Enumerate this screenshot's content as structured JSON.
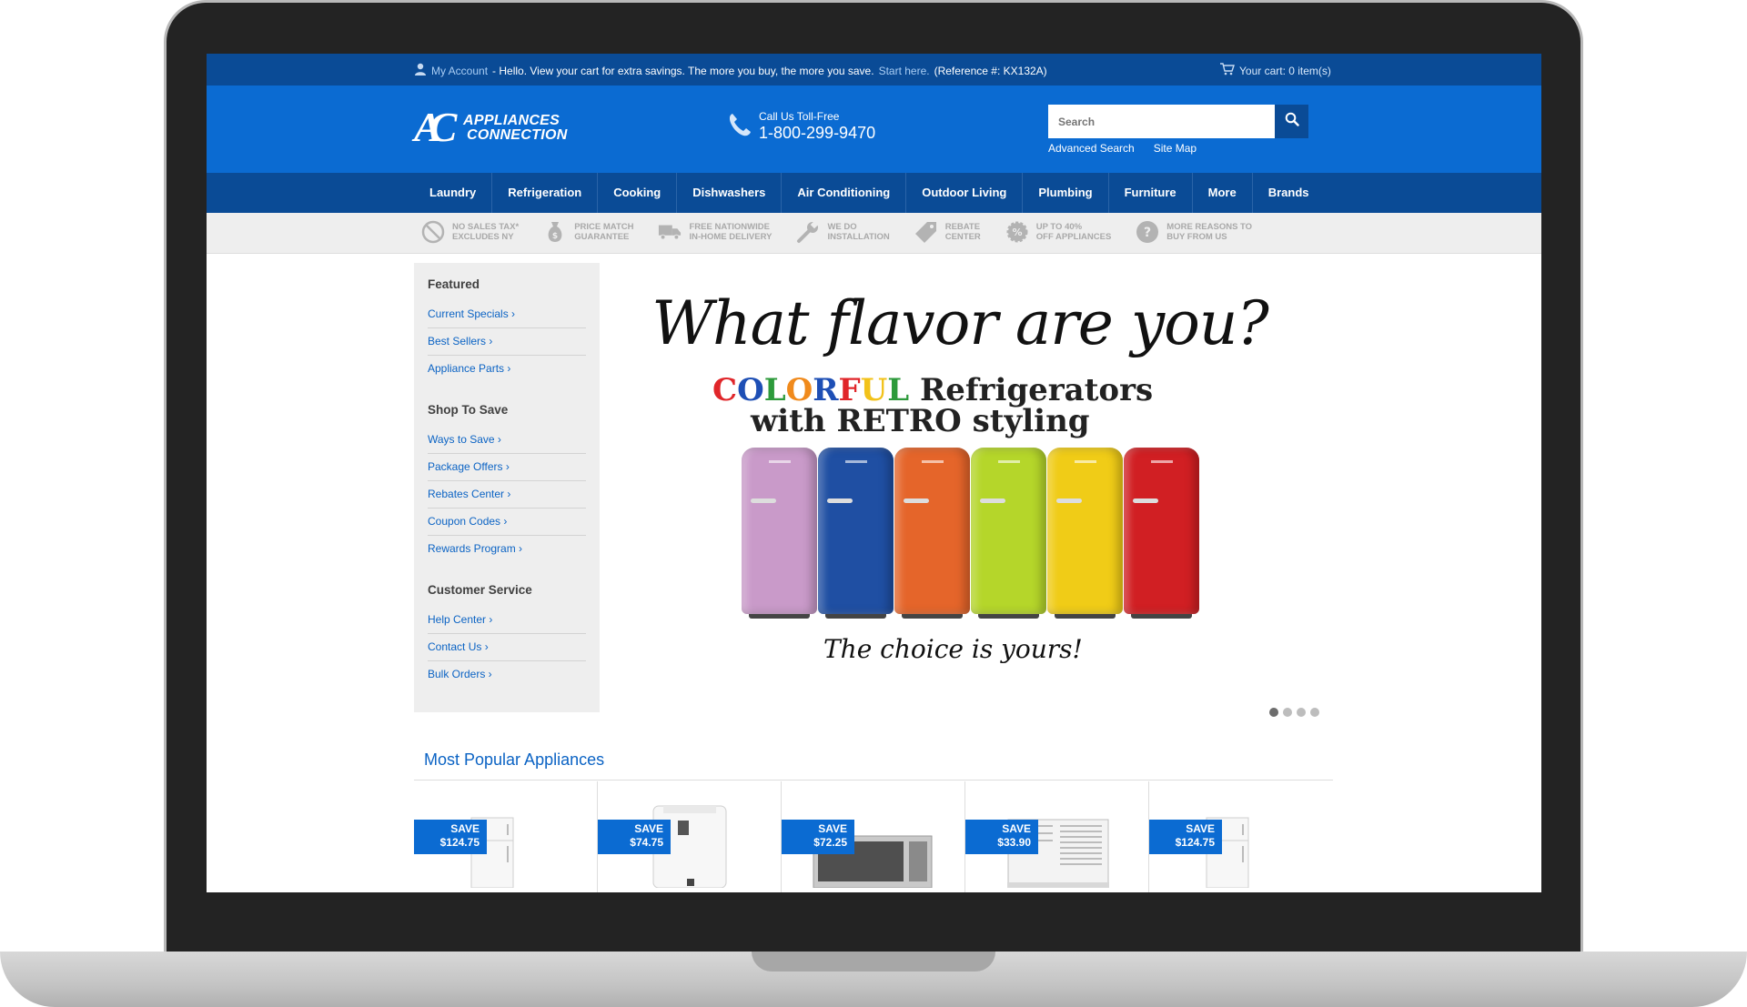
{
  "topbar": {
    "account": "My Account",
    "message": "- Hello. View your cart for extra savings. The more you buy, the more you save.",
    "start_link": "Start here.",
    "reference": "(Reference #: KX132A)",
    "cart": "Your cart: 0 item(s)"
  },
  "header": {
    "logo_line1": "APPLIANCES",
    "logo_line2": "CONNECTION",
    "logo_mark": "AC",
    "phone_label": "Call Us Toll-Free",
    "phone_number": "1-800-299-9470",
    "search_placeholder": "Search",
    "advanced_search": "Advanced Search",
    "site_map": "Site Map"
  },
  "nav": [
    "Laundry",
    "Refrigeration",
    "Cooking",
    "Dishwashers",
    "Air Conditioning",
    "Outdoor Living",
    "Plumbing",
    "Furniture",
    "More",
    "Brands"
  ],
  "benefits": [
    {
      "icon": "no-tax-icon",
      "line1": "NO SALES TAX*",
      "line2": "EXCLUDES NY"
    },
    {
      "icon": "money-bag-icon",
      "line1": "PRICE MATCH",
      "line2": "GUARANTEE"
    },
    {
      "icon": "truck-icon",
      "line1": "FREE NATIONWIDE",
      "line2": "IN-HOME DELIVERY"
    },
    {
      "icon": "wrench-icon",
      "line1": "WE DO",
      "line2": "INSTALLATION"
    },
    {
      "icon": "tag-icon",
      "line1": "REBATE",
      "line2": "CENTER"
    },
    {
      "icon": "percent-icon",
      "line1": "UP TO 40%",
      "line2": "OFF APPLIANCES"
    },
    {
      "icon": "question-icon",
      "line1": "MORE REASONS TO",
      "line2": "BUY FROM US"
    }
  ],
  "sidebar": {
    "featured_title": "Featured",
    "featured": [
      "Current Specials ›",
      "Best Sellers ›",
      "Appliance Parts ›"
    ],
    "shop_title": "Shop To Save",
    "shop": [
      "Ways to Save ›",
      "Package Offers ›",
      "Rebates Center ›",
      "Coupon Codes ›",
      "Rewards Program ›"
    ],
    "service_title": "Customer Service",
    "service": [
      "Help Center ›",
      "Contact Us ›",
      "Bulk Orders ›"
    ]
  },
  "hero": {
    "headline": "What flavor are you?",
    "colorful": [
      "C",
      "O",
      "L",
      "O",
      "R",
      "F",
      "U",
      "L"
    ],
    "colorful_colors": [
      "#e0262a",
      "#1e4fb5",
      "#2d9a3b",
      "#f08a1c",
      "#1e4fb5",
      "#e0262a",
      "#f2c21a",
      "#2d9a3b"
    ],
    "line2_rest": " Refrigerators",
    "line3": "with RETRO styling",
    "tagline": "The choice is yours!",
    "fridge_colors": [
      "#c99ac9",
      "#1f4fa3",
      "#e5652a",
      "#b5d62a",
      "#f0cc17",
      "#d11f23"
    ],
    "slide_dots": 4,
    "active_slide": 1
  },
  "popular": {
    "title": "Most Popular Appliances",
    "products": [
      {
        "save_label": "SAVE",
        "amount": "$124.75",
        "kind": "refrigerator"
      },
      {
        "save_label": "SAVE",
        "amount": "$74.75",
        "kind": "dehumidifier"
      },
      {
        "save_label": "SAVE",
        "amount": "$72.25",
        "kind": "microwave"
      },
      {
        "save_label": "SAVE",
        "amount": "$33.90",
        "kind": "air-conditioner"
      },
      {
        "save_label": "SAVE",
        "amount": "$124.75",
        "kind": "refrigerator"
      }
    ]
  }
}
